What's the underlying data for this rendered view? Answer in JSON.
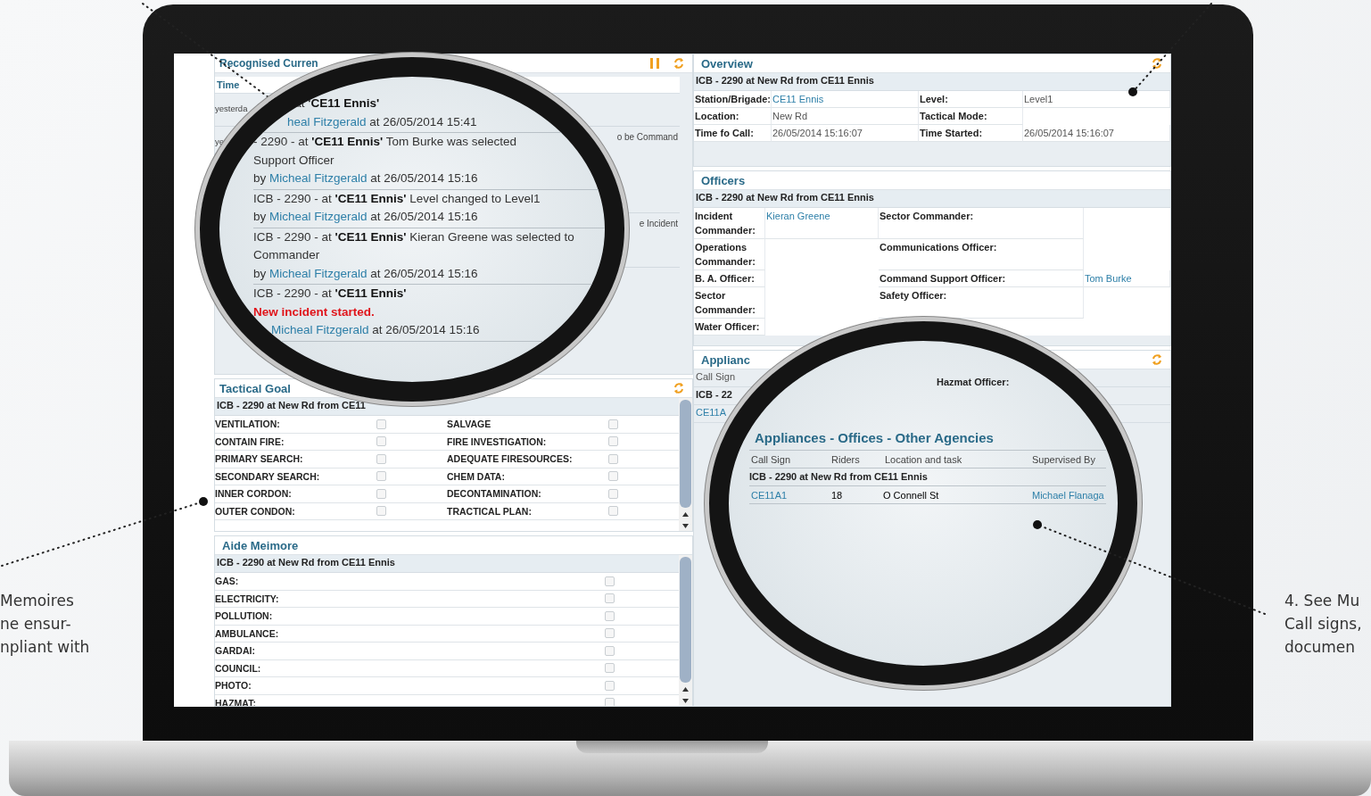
{
  "captions_left": [
    "Memoires",
    "ne ensur-",
    "npliant with"
  ],
  "captions_right": [
    "4. See Mu",
    "Call signs,",
    "documen"
  ],
  "events_panel": {
    "title": "Recognised Curren",
    "column_1": "Time",
    "rows": [
      {
        "time": "yesterda"
      },
      {
        "time": "ye",
        "message": "o be Command"
      },
      {
        "message": "e Incident"
      }
    ]
  },
  "lens_log": {
    "entries": [
      {
        "lines": [
          {
            "kind": "event",
            "text": "- at **'CE11 Ennis'**"
          },
          {
            "kind": "by",
            "user": "heal Fitzgerald",
            "suffix": "at 26/05/2014 15:41"
          }
        ]
      },
      {
        "lines": [
          {
            "kind": "event",
            "text": "- 2290 - at **'CE11 Ennis'** Tom Burke was selected"
          },
          {
            "kind": "event",
            "text": "Support Officer"
          },
          {
            "kind": "by",
            "prefix": "by",
            "user": "Micheal Fitzgerald",
            "suffix": "at 26/05/2014 15:16"
          }
        ]
      },
      {
        "lines": [
          {
            "kind": "event",
            "text": "ICB - 2290 - at **'CE11 Ennis'** Level changed to Level1"
          },
          {
            "kind": "by",
            "prefix": "by",
            "user": "Micheal Fitzgerald",
            "suffix": "at 26/05/2014 15:16"
          }
        ]
      },
      {
        "lines": [
          {
            "kind": "event",
            "text": "ICB - 2290 - at **'CE11 Ennis'** Kieran Greene was selected to"
          },
          {
            "kind": "event",
            "text": "Commander"
          },
          {
            "kind": "by",
            "prefix": "by",
            "user": "Micheal Fitzgerald",
            "suffix": "at 26/05/2014 15:16"
          }
        ]
      },
      {
        "lines": [
          {
            "kind": "event",
            "text": "ICB - 2290 - at **'CE11 Ennis'**"
          },
          {
            "kind": "alert",
            "text": "New incident started."
          },
          {
            "kind": "by",
            "user": "Micheal Fitzgerald",
            "suffix": "at 26/05/2014 15:16"
          }
        ]
      }
    ]
  },
  "tactical_goals": {
    "title": "Tactical Goal",
    "incident": "ICB - 2290 at New Rd from CE11",
    "items": [
      {
        "label": "VENTILATION:",
        "checked": false
      },
      {
        "label": "SALVAGE",
        "checked": false
      },
      {
        "label": "CONTAIN FIRE:",
        "checked": false
      },
      {
        "label": "FIRE INVESTIGATION:",
        "checked": false
      },
      {
        "label": "PRIMARY SEARCH:",
        "checked": false
      },
      {
        "label": "ADEQUATE FIRESOURCES:",
        "checked": false
      },
      {
        "label": "SECONDARY SEARCH:",
        "checked": false
      },
      {
        "label": "CHEM DATA:",
        "checked": false
      },
      {
        "label": "INNER CORDON:",
        "checked": false
      },
      {
        "label": "DECONTAMINATION:",
        "checked": false
      },
      {
        "label": "OUTER CONDON:",
        "checked": false
      },
      {
        "label": "TRACTICAL PLAN:",
        "checked": false
      }
    ]
  },
  "aide_memoire": {
    "title": "Aide Meimore",
    "incident": "ICB - 2290 at New Rd from CE11 Ennis",
    "items": [
      {
        "label": "GAS:",
        "checked": false
      },
      {
        "label": "ELECTRICITY:",
        "checked": false
      },
      {
        "label": "POLLUTION:",
        "checked": false
      },
      {
        "label": "AMBULANCE:",
        "checked": false
      },
      {
        "label": "GARDAI:",
        "checked": false
      },
      {
        "label": "COUNCIL:",
        "checked": false
      },
      {
        "label": "PHOTO:",
        "checked": false
      },
      {
        "label": "HAZMAT:",
        "checked": false
      }
    ]
  },
  "overview": {
    "title": "Overview",
    "incident": "ICB - 2290 at New Rd from CE11 Ennis",
    "fields": [
      {
        "label": "Station/Brigade:",
        "value": "CE11 Ennis",
        "kind": "link"
      },
      {
        "label": "Level:",
        "value": "Level1",
        "kind": "text"
      },
      {
        "label": "Location:",
        "value": "New Rd",
        "kind": "text"
      },
      {
        "label": "Tactical Mode:",
        "kind": "text"
      },
      {
        "label": "Time fo Call:",
        "value": "26/05/2014 15:16:07",
        "kind": "text"
      },
      {
        "label": "Time Started:",
        "value": "26/05/2014 15:16:07",
        "kind": "text"
      }
    ]
  },
  "officers": {
    "title": "Officers",
    "incident": "ICB - 2290 at New Rd from CE11 Ennis",
    "fields": [
      {
        "label": "Incident Commander:",
        "value": "Kieran Greene",
        "kind": "link"
      },
      {
        "label": "Sector Commander:",
        "kind": "text"
      },
      {
        "label": "Operations Commander:",
        "kind": "text"
      },
      {
        "label": "Communications Officer:",
        "kind": "text"
      },
      {
        "label": "B. A. Officer:",
        "kind": "text"
      },
      {
        "label": "Command Support Officer:",
        "value": "Tom Burke",
        "kind": "link"
      },
      {
        "label": "Sector Commander:",
        "kind": "text"
      },
      {
        "label": "Safety Officer:",
        "kind": "text"
      },
      {
        "label": "Water Officer:",
        "kind": "text"
      }
    ]
  },
  "appliances_panel": {
    "title": "Applianc",
    "column_1": "Call Sign",
    "rows": [
      {
        "kind": "group",
        "text": "ICB - 22"
      },
      {
        "kind": "link",
        "text": "CE11A"
      }
    ]
  },
  "lens_appliances": {
    "officer_label": "Hazmat Officer:",
    "title": "Appliances - Offices - Other Agencies",
    "columns": [
      "Call Sign",
      "Riders",
      "Location and task",
      "Supervised By"
    ],
    "group": "ICB - 2290 at New Rd from CE11 Ennis",
    "rows": [
      {
        "call_sign": "CE11A1",
        "riders": "18",
        "location": "O Connell St",
        "supervised_by": "Michael Flanaga"
      }
    ]
  }
}
